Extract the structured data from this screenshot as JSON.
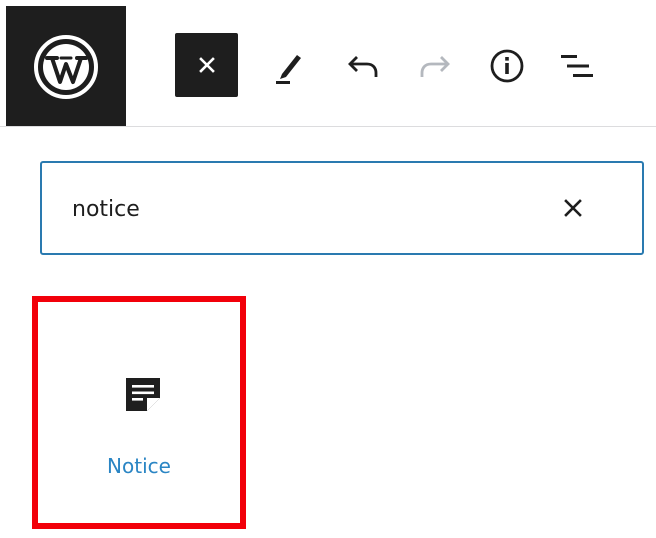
{
  "toolbar": {
    "logo_icon": "wordpress-logo-icon",
    "buttons": [
      {
        "name": "close-inserter-button",
        "icon": "close-icon"
      },
      {
        "name": "tools-edit-button",
        "icon": "pencil-icon"
      },
      {
        "name": "undo-button",
        "icon": "undo-icon"
      },
      {
        "name": "redo-button",
        "icon": "redo-icon",
        "state": "disabled"
      },
      {
        "name": "details-button",
        "icon": "info-icon"
      },
      {
        "name": "list-view-button",
        "icon": "list-view-icon"
      }
    ]
  },
  "search": {
    "value": "notice",
    "clear_icon": "close-icon"
  },
  "results": {
    "blocks": [
      {
        "label": "Notice",
        "icon": "notice-document-icon",
        "highlighted": true
      }
    ]
  },
  "colors": {
    "dark": "#1e1e1e",
    "accent_blue": "#2a7ab0",
    "link_blue": "#2a85c4",
    "highlight_red": "#f2000a",
    "disabled_gray": "#b4b8be"
  }
}
